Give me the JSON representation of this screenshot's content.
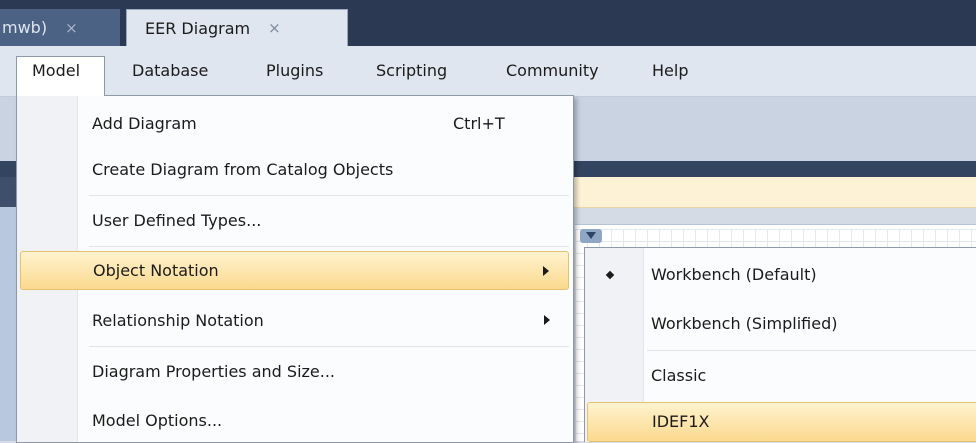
{
  "tabs": [
    {
      "label": "mwb)",
      "close": "×"
    },
    {
      "label": "EER Diagram",
      "close": "×"
    }
  ],
  "menubar": [
    "Model",
    "Database",
    "Plugins",
    "Scripting",
    "Community",
    "Help"
  ],
  "model_menu": {
    "items": [
      {
        "label": "Add Diagram",
        "shortcut": "Ctrl+T"
      },
      {
        "label": "Create Diagram from Catalog Objects"
      },
      {
        "label": "User Defined Types..."
      },
      {
        "label": "Object Notation",
        "submenu": true,
        "highlighted": true
      },
      {
        "label": "Relationship Notation",
        "submenu": true
      },
      {
        "label": "Diagram Properties and Size..."
      },
      {
        "label": "Model Options..."
      }
    ]
  },
  "object_notation_submenu": {
    "items": [
      {
        "label": "Workbench (Default)",
        "checked": true
      },
      {
        "label": "Workbench (Simplified)"
      },
      {
        "label": "Classic"
      },
      {
        "label": "IDEF1X",
        "highlighted": true
      }
    ]
  },
  "colors": {
    "highlight": "#fbd98e",
    "tabstrip": "#2b3a52",
    "menubar": "#dfe6ef"
  }
}
